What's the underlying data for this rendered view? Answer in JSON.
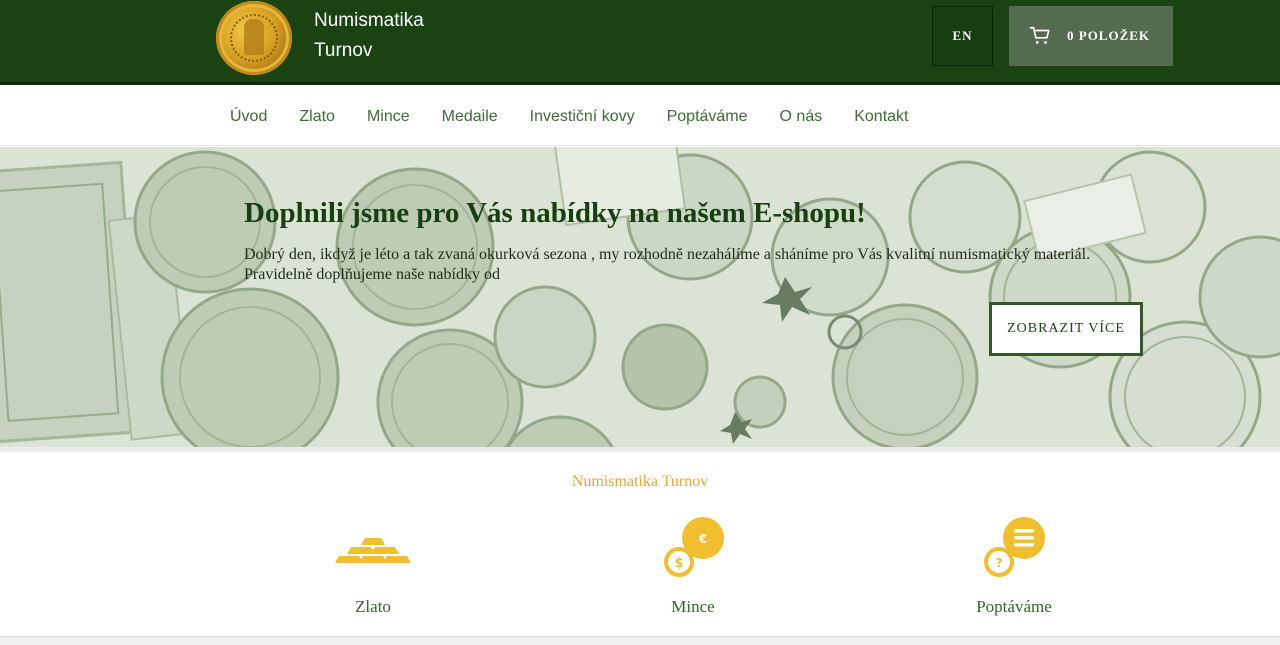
{
  "header": {
    "brand": "Numismatika Turnov",
    "lang_button": "EN",
    "cart_label": "0 POLOŽEK"
  },
  "nav": {
    "items": [
      "Úvod",
      "Zlato",
      "Mince",
      "Medaile",
      "Investiční kovy",
      "Poptáváme",
      "O nás",
      "Kontakt"
    ]
  },
  "hero": {
    "title": "Doplnili jsme pro Vás nabídky na našem E-shopu!",
    "text": "Dobrý den, ikdyž je léto a tak zvaná okurková sezona , my rozhodně nezahálíme a sháníme pro Vás kvalitní numismatický materiál. Pravidelně doplňujeme naše nabídky od",
    "button": "ZOBRAZIT VÍCE"
  },
  "features": {
    "title": "Numismatika Turnov",
    "items": [
      {
        "label": "Zlato",
        "icon": "gold-bars-icon"
      },
      {
        "label": "Mince",
        "icon": "coins-euro-dollar-icon"
      },
      {
        "label": "Poptáváme",
        "icon": "coin-list-question-icon"
      }
    ]
  },
  "colors": {
    "header_bg": "#1a4212",
    "accent_gold": "#f0be2e",
    "nav_text": "#3f6b37"
  }
}
